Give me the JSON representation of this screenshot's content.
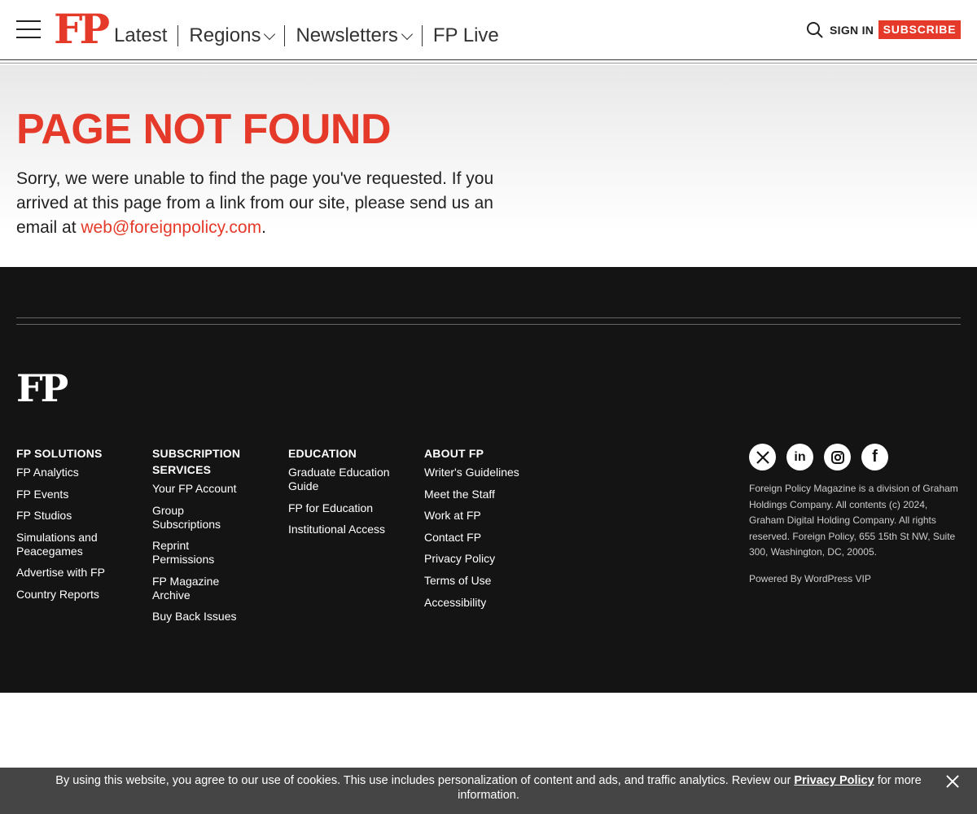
{
  "header": {
    "logo": "FP",
    "nav": [
      {
        "label": "Latest"
      },
      {
        "label": "Regions"
      },
      {
        "label": "Newsletters"
      },
      {
        "label": "FP Live"
      }
    ],
    "sign_in": "SIGN IN",
    "subscribe": "SUBSCRIBE"
  },
  "hero": {
    "title": "PAGE NOT FOUND",
    "message_before": "Sorry, we were unable to find the page you've requested. If you arrived at this page from a link from our site, please send us an email at ",
    "email": "web@foreignpolicy.com",
    "message_after": "."
  },
  "footer": {
    "logo": "FP",
    "columns": [
      {
        "heading": "FP SOLUTIONS",
        "links": [
          "FP Analytics",
          "FP Events",
          "FP Studios",
          "Simulations and Peacegames",
          "Advertise with FP",
          "Country Reports"
        ]
      },
      {
        "heading": "SUBSCRIPTION SERVICES",
        "links": [
          "Your FP Account",
          "Group Subscriptions",
          "Reprint Permissions",
          "FP Magazine Archive",
          "Buy Back Issues"
        ]
      },
      {
        "heading": "EDUCATION",
        "links": [
          "Graduate Education Guide",
          "FP for Education",
          "Institutional Access"
        ]
      },
      {
        "heading": "ABOUT FP",
        "links": [
          "Writer's Guidelines",
          "Meet the Staff",
          "Work at FP",
          "Contact FP",
          "Privacy Policy",
          "Terms of Use",
          "Accessibility"
        ]
      }
    ],
    "social": [
      "x-icon",
      "linkedin-icon",
      "instagram-icon",
      "facebook-icon"
    ],
    "legal": "Foreign Policy Magazine is a division of Graham Holdings Company. All contents (c) 2024, Graham Digital Holding Company. All rights reserved. Foreign Policy, 655 15th St NW, Suite 300, Washington, DC, 20005.",
    "powered_by": "Powered By WordPress VIP"
  },
  "cookie": {
    "text_before": "By using this website, you agree to our use of cookies. This use includes personalization of content and ads, and traffic analytics. Review our ",
    "link": "Privacy Policy",
    "text_after": " for more information."
  },
  "colors": {
    "brand_red": "#e53a2a",
    "footer_bg": "#141414",
    "cookie_bg": "#454545"
  }
}
